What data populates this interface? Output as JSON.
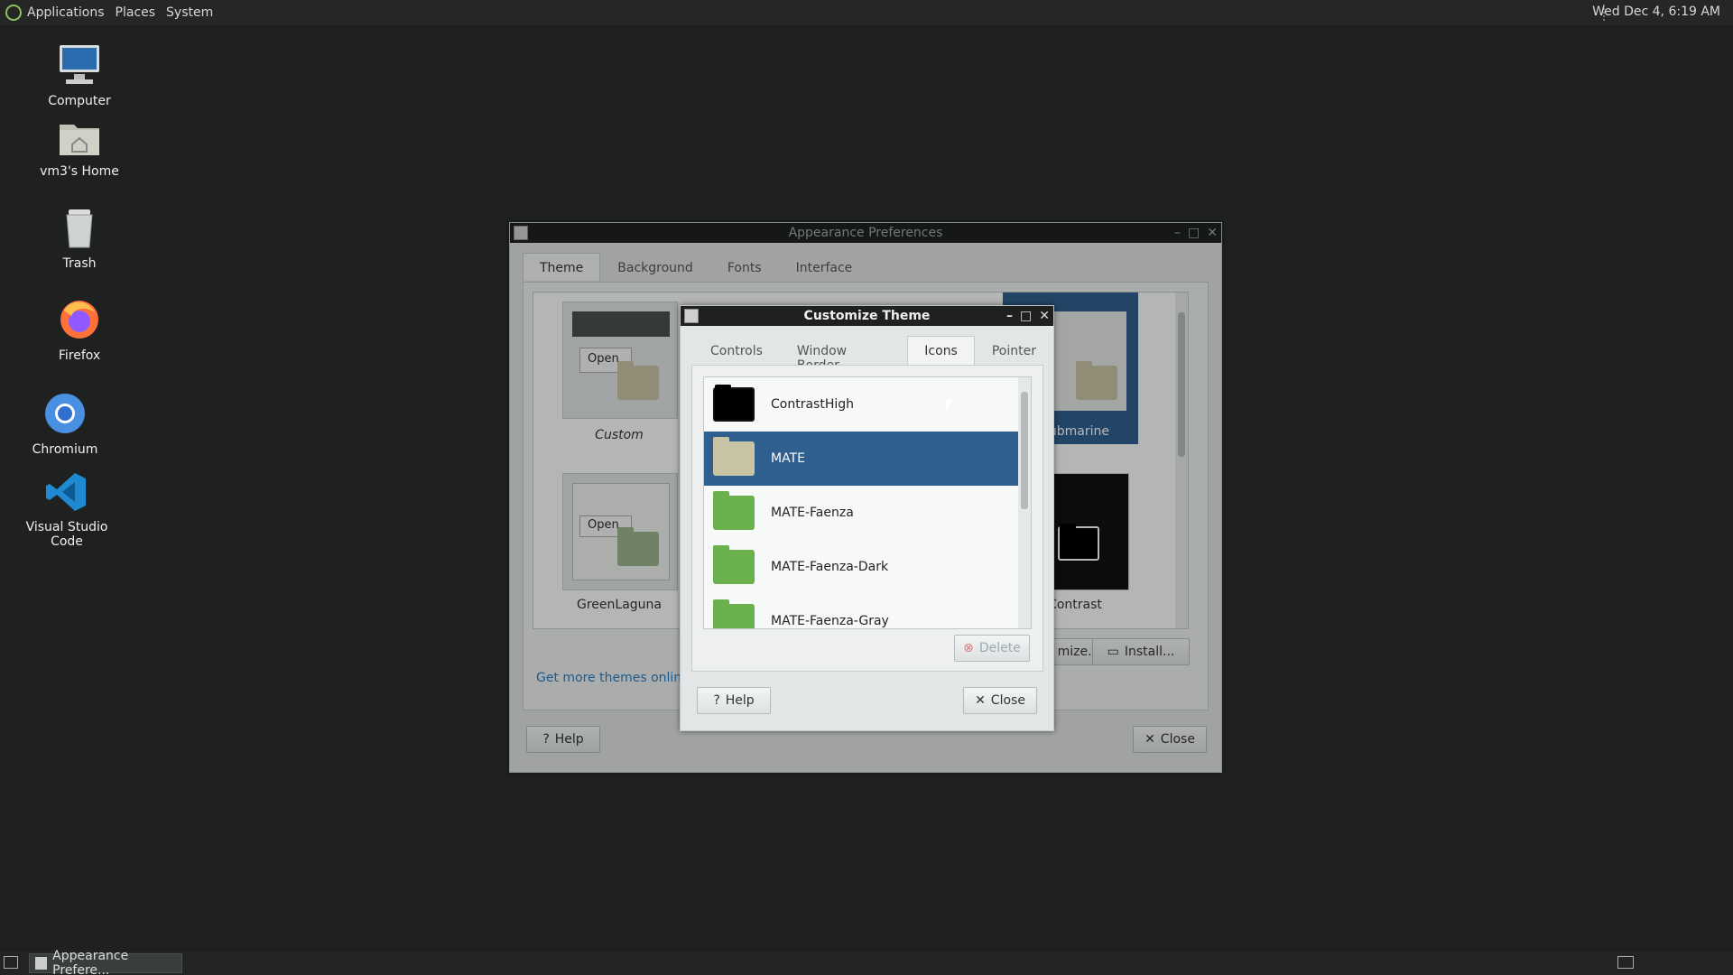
{
  "topbar": {
    "menus": [
      "Applications",
      "Places",
      "System"
    ],
    "clock": "Wed Dec 4, 6:19 AM"
  },
  "desktop": {
    "icons": [
      "Computer",
      "vm3's Home",
      "Trash",
      "Firefox",
      "Chromium",
      "Visual Studio Code"
    ]
  },
  "appearance": {
    "title": "Appearance Preferences",
    "tabs": [
      "Theme",
      "Background",
      "Fonts",
      "Interface"
    ],
    "themes": [
      "Custom",
      "GreenLaguna",
      "Submarine",
      "Contrast"
    ],
    "get_more": "Get more themes online",
    "customize_btn": "mize...",
    "install_btn": "Install...",
    "help_btn": "Help",
    "close_btn": "Close"
  },
  "customize": {
    "title": "Customize Theme",
    "tabs": [
      "Controls",
      "Window Border",
      "Icons",
      "Pointer"
    ],
    "icon_themes": [
      "ContrastHigh",
      "MATE",
      "MATE-Faenza",
      "MATE-Faenza-Dark",
      "MATE-Faenza-Gray"
    ],
    "selected": "MATE",
    "delete_btn": "Delete",
    "help_btn": "Help",
    "close_btn": "Close"
  },
  "thumb_text": {
    "open": "Open"
  },
  "taskbar": {
    "item": "Appearance Prefere..."
  },
  "colors": {
    "selection": "#2f5f8e",
    "link": "#2a7fc0",
    "green_folder": "#6ab04c",
    "beige_folder": "#c8c3a4"
  }
}
